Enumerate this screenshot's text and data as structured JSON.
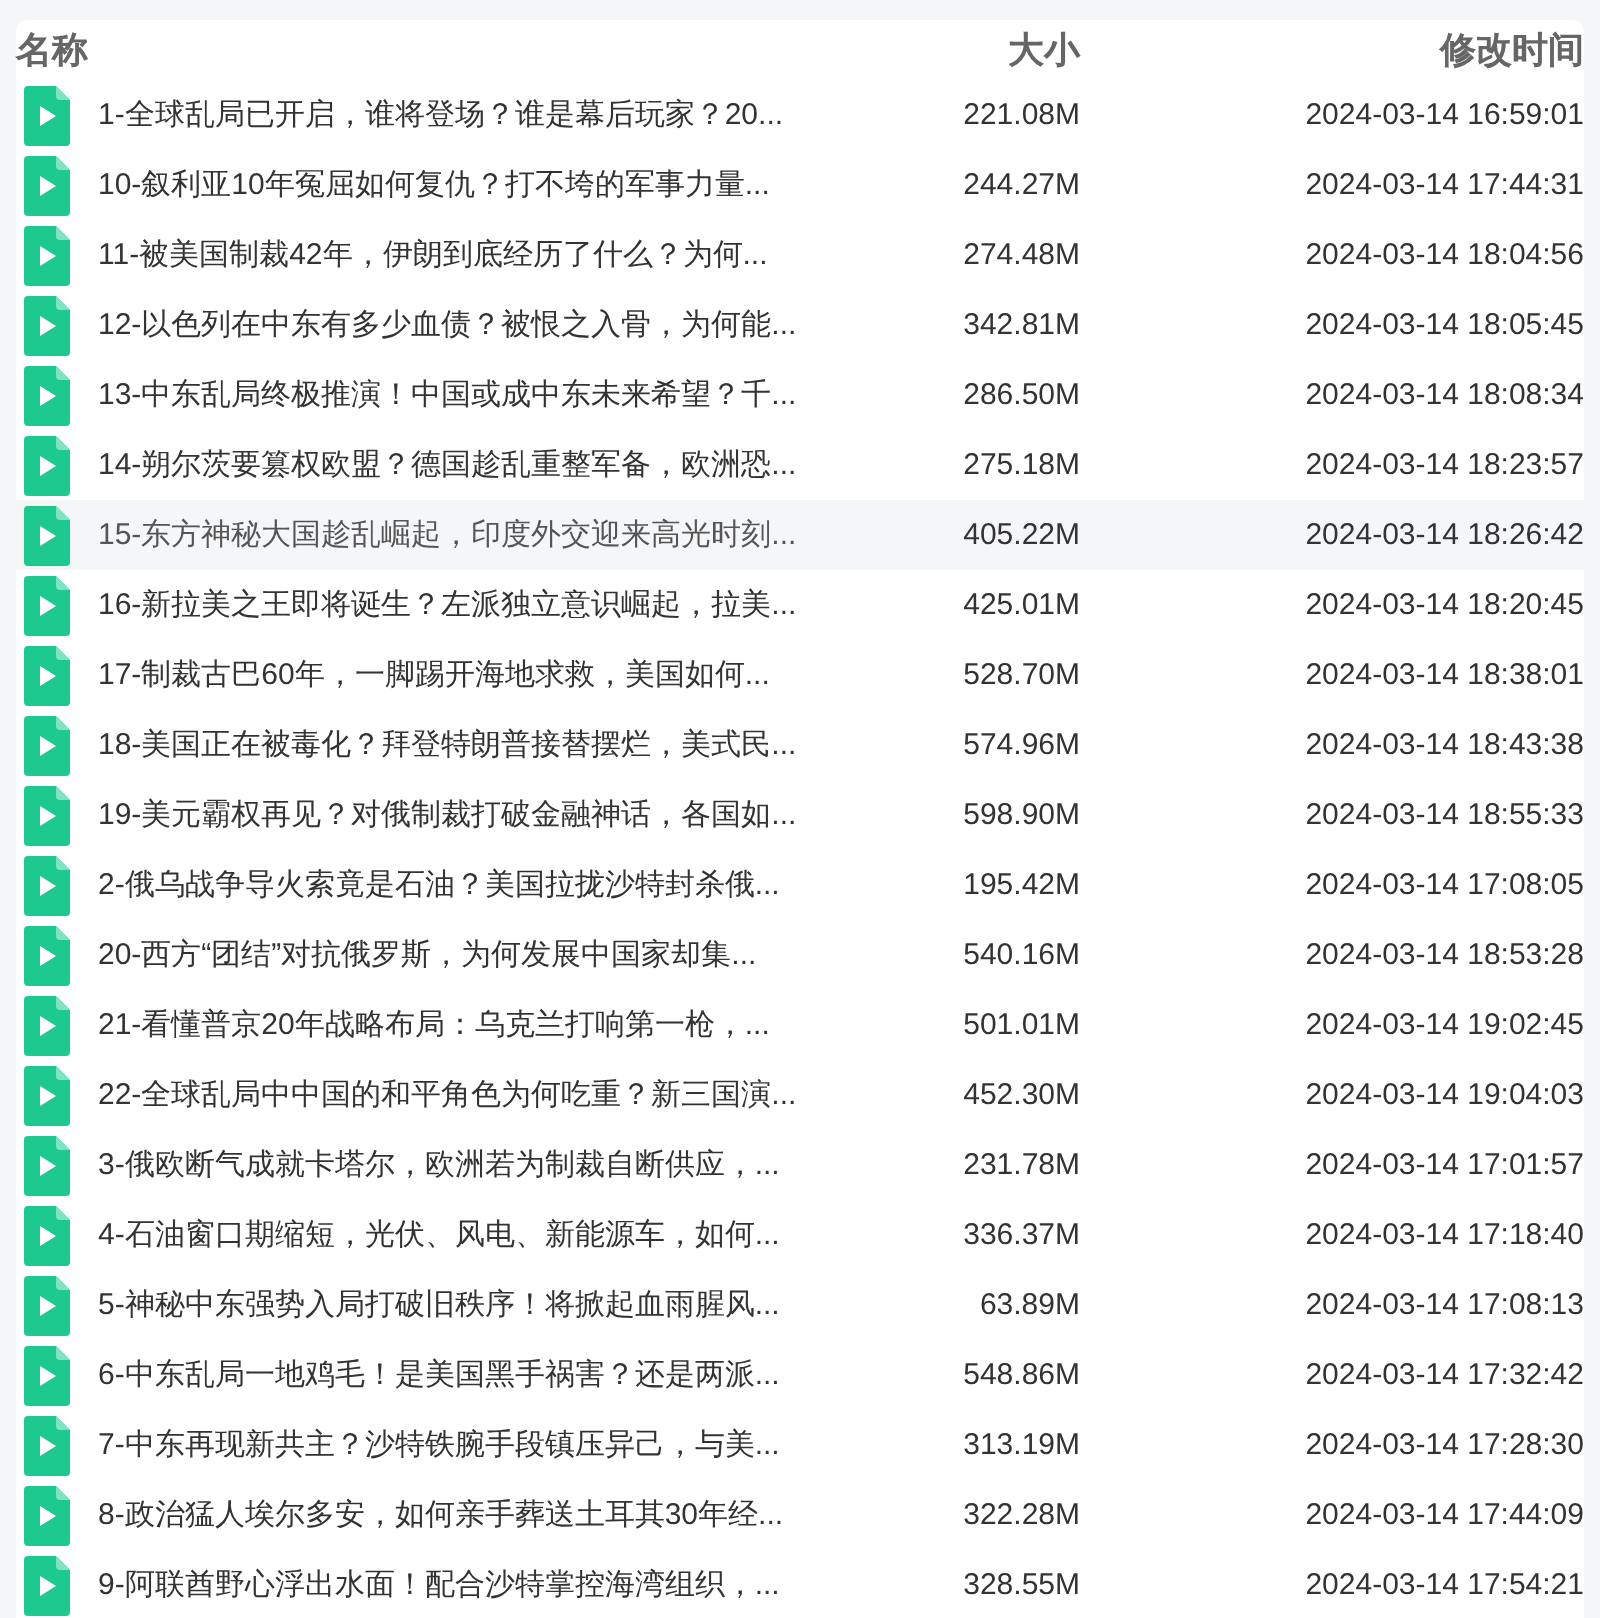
{
  "table": {
    "columns": [
      "名称",
      "大小",
      "修改时间"
    ],
    "rows": [
      {
        "name": "1-全球乱局已开启，谁将登场？谁是幕后玩家？20...",
        "size": "221.08M",
        "modified": "2024-03-14 16:59:01",
        "selected": false
      },
      {
        "name": "10-叙利亚10年冤屈如何复仇？打不垮的军事力量...",
        "size": "244.27M",
        "modified": "2024-03-14 17:44:31",
        "selected": false
      },
      {
        "name": "11-被美国制裁42年，伊朗到底经历了什么？为何...",
        "size": "274.48M",
        "modified": "2024-03-14 18:04:56",
        "selected": false
      },
      {
        "name": "12-以色列在中东有多少血债？被恨之入骨，为何能...",
        "size": "342.81M",
        "modified": "2024-03-14 18:05:45",
        "selected": false
      },
      {
        "name": "13-中东乱局终极推演！中国或成中东未来希望？千...",
        "size": "286.50M",
        "modified": "2024-03-14 18:08:34",
        "selected": false
      },
      {
        "name": "14-朔尔茨要篡权欧盟？德国趁乱重整军备，欧洲恐...",
        "size": "275.18M",
        "modified": "2024-03-14 18:23:57",
        "selected": false
      },
      {
        "name": "15-东方神秘大国趁乱崛起，印度外交迎来高光时刻...",
        "size": "405.22M",
        "modified": "2024-03-14 18:26:42",
        "selected": true
      },
      {
        "name": "16-新拉美之王即将诞生？左派独立意识崛起，拉美...",
        "size": "425.01M",
        "modified": "2024-03-14 18:20:45",
        "selected": false
      },
      {
        "name": "17-制裁古巴60年，一脚踢开海地求救，美国如何...",
        "size": "528.70M",
        "modified": "2024-03-14 18:38:01",
        "selected": false
      },
      {
        "name": "18-美国正在被毒化？拜登特朗普接替摆烂，美式民...",
        "size": "574.96M",
        "modified": "2024-03-14 18:43:38",
        "selected": false
      },
      {
        "name": "19-美元霸权再见？对俄制裁打破金融神话，各国如...",
        "size": "598.90M",
        "modified": "2024-03-14 18:55:33",
        "selected": false
      },
      {
        "name": "2-俄乌战争导火索竟是石油？美国拉拢沙特封杀俄...",
        "size": "195.42M",
        "modified": "2024-03-14 17:08:05",
        "selected": false
      },
      {
        "name": "20-西方“团结”对抗俄罗斯，为何发展中国家却集...",
        "size": "540.16M",
        "modified": "2024-03-14 18:53:28",
        "selected": false
      },
      {
        "name": "21-看懂普京20年战略布局：乌克兰打响第一枪，...",
        "size": "501.01M",
        "modified": "2024-03-14 19:02:45",
        "selected": false
      },
      {
        "name": "22-全球乱局中中国的和平角色为何吃重？新三国演...",
        "size": "452.30M",
        "modified": "2024-03-14 19:04:03",
        "selected": false
      },
      {
        "name": "3-俄欧断气成就卡塔尔，欧洲若为制裁自断供应，...",
        "size": "231.78M",
        "modified": "2024-03-14 17:01:57",
        "selected": false
      },
      {
        "name": "4-石油窗口期缩短，光伏、风电、新能源车，如何...",
        "size": "336.37M",
        "modified": "2024-03-14 17:18:40",
        "selected": false
      },
      {
        "name": "5-神秘中东强势入局打破旧秩序！将掀起血雨腥风...",
        "size": "63.89M",
        "modified": "2024-03-14 17:08:13",
        "selected": false
      },
      {
        "name": "6-中东乱局一地鸡毛！是美国黑手祸害？还是两派...",
        "size": "548.86M",
        "modified": "2024-03-14 17:32:42",
        "selected": false
      },
      {
        "name": "7-中东再现新共主？沙特铁腕手段镇压异己，与美...",
        "size": "313.19M",
        "modified": "2024-03-14 17:28:30",
        "selected": false
      },
      {
        "name": "8-政治猛人埃尔多安，如何亲手葬送土耳其30年经...",
        "size": "322.28M",
        "modified": "2024-03-14 17:44:09",
        "selected": false
      },
      {
        "name": "9-阿联酋野心浮出水面！配合沙特掌控海湾组织，...",
        "size": "328.55M",
        "modified": "2024-03-14 17:54:21",
        "selected": false
      }
    ]
  }
}
